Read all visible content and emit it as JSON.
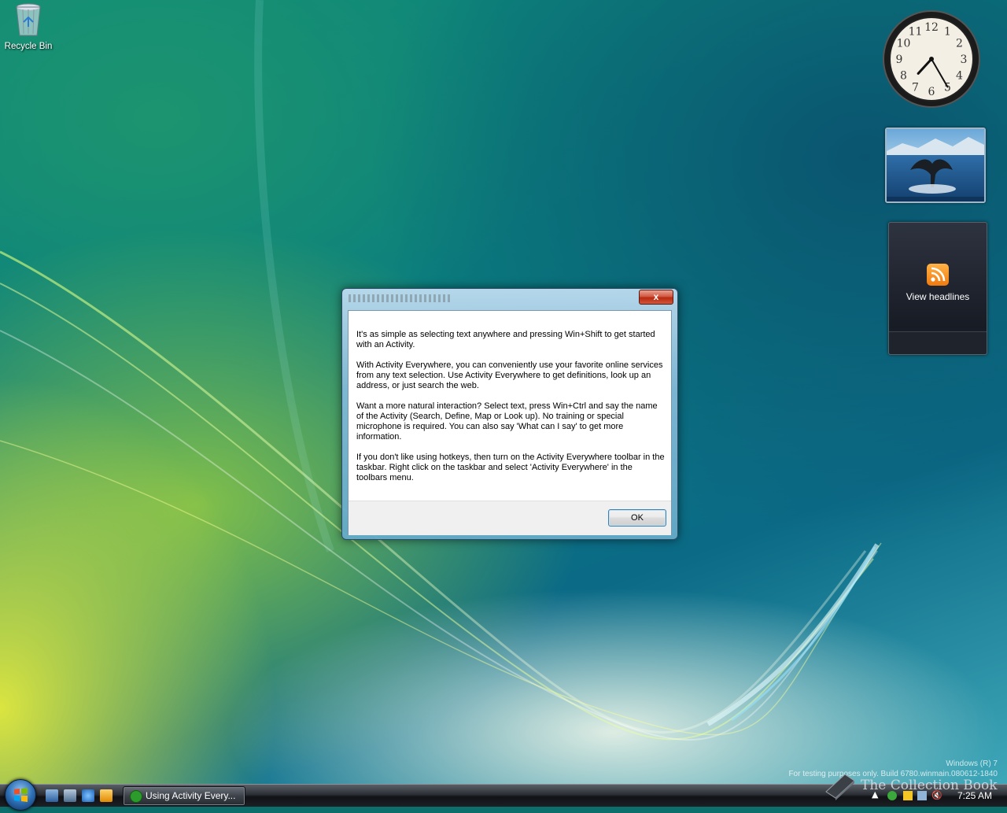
{
  "desktop": {
    "icons": [
      {
        "label": "Recycle Bin",
        "icon": "recycle-bin-icon"
      }
    ]
  },
  "gadgets": {
    "clock": {
      "hour": 7,
      "minute": 25
    },
    "feed": {
      "label": "View headlines",
      "icon": "rss-icon"
    }
  },
  "dialog": {
    "close_label": "x",
    "paragraphs": [
      "It's as simple as selecting text anywhere and pressing Win+Shift to get started with an Activity.",
      "With Activity Everywhere, you can conveniently use your favorite online services from any text selection. Use Activity Everywhere to get definitions, look up an address, or just search the web.",
      "Want a more natural interaction? Select text, press Win+Ctrl and say the name of the Activity (Search, Define, Map or Look up).  No training or special microphone is required. You can also say 'What can I say' to get more information.",
      "If you don't like using hotkeys, then turn on the Activity Everywhere toolbar in the taskbar. Right click on the taskbar and select 'Activity Everywhere' in the toolbars menu."
    ],
    "ok_label": "OK"
  },
  "watermark": {
    "line1": "Windows (R) 7",
    "line2": "For testing purposes only. Build 6780.winmain.080612-1840"
  },
  "logo_text": "The Collection Book",
  "taskbar": {
    "task_label": "Using Activity Every...",
    "time": "7:25 AM"
  }
}
